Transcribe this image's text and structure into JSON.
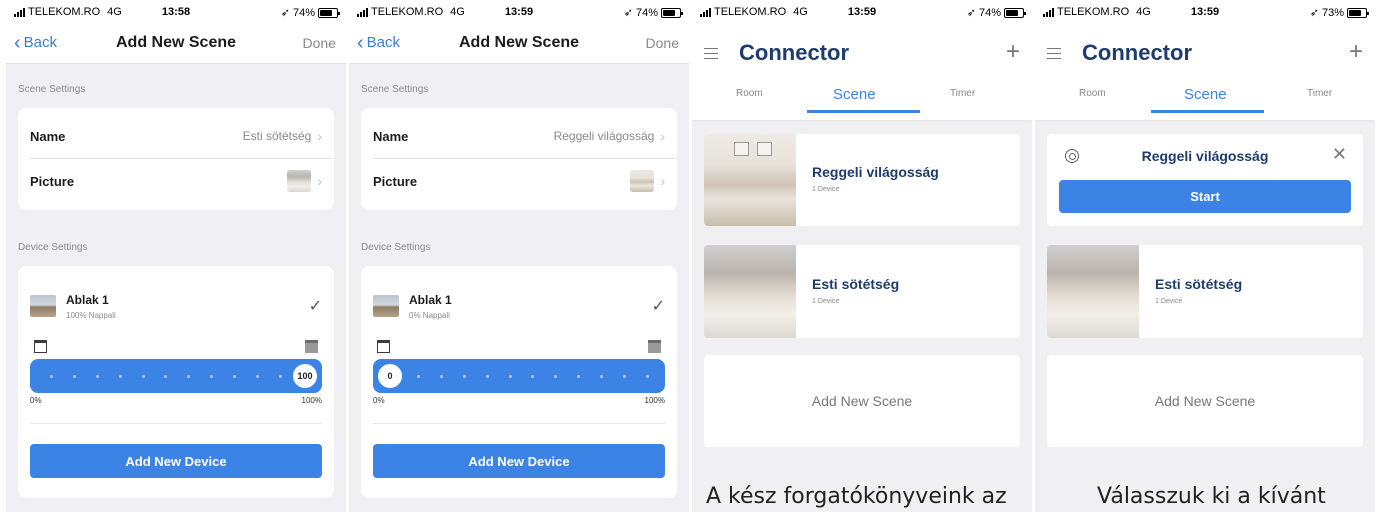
{
  "colors": {
    "accent": "#3c83e6",
    "title_navy": "#1e3c6e",
    "background": "#efeff4"
  },
  "status": [
    {
      "carrier": "TELEKOM.RO",
      "network": "4G",
      "time": "13:58",
      "battery": "74%",
      "battery_level": 0.74
    },
    {
      "carrier": "TELEKOM.RO",
      "network": "4G",
      "time": "13:59",
      "battery": "74%",
      "battery_level": 0.74
    },
    {
      "carrier": "TELEKOM.RO",
      "network": "4G",
      "time": "13:59",
      "battery": "74%",
      "battery_level": 0.74
    },
    {
      "carrier": "TELEKOM.RO",
      "network": "4G",
      "time": "13:59",
      "battery": "73%",
      "battery_level": 0.73
    }
  ],
  "add_scene": {
    "back": "Back",
    "title": "Add New Scene",
    "done": "Done",
    "scene_settings": "Scene Settings",
    "name_label": "Name",
    "picture_label": "Picture",
    "device_settings": "Device Settings",
    "add_device": "Add New Device",
    "min_label": "0%",
    "max_label": "100%"
  },
  "screen1": {
    "name_value": "Esti sötétség",
    "device": {
      "title": "Ablak 1",
      "subtitle": "100% Nappali",
      "slider_value": "100",
      "level": 1.0
    }
  },
  "screen2": {
    "name_value": "Reggeli világosság",
    "device": {
      "title": "Ablak 1",
      "subtitle": "0% Nappali",
      "slider_value": "0",
      "level": 0.0
    }
  },
  "connector": {
    "title": "Connector",
    "tabs": [
      "Room",
      "Scene",
      "Timer"
    ],
    "active_tab": "Scene",
    "scenes": [
      {
        "name": "Reggeli világosság",
        "count": "1 Device"
      },
      {
        "name": "Esti sötétség",
        "count": "1 Device"
      }
    ],
    "add_scene": "Add New Scene",
    "start": "Start"
  },
  "captions": [
    "A kész forgatókönyveink az",
    "Válasszuk ki a kívánt"
  ]
}
